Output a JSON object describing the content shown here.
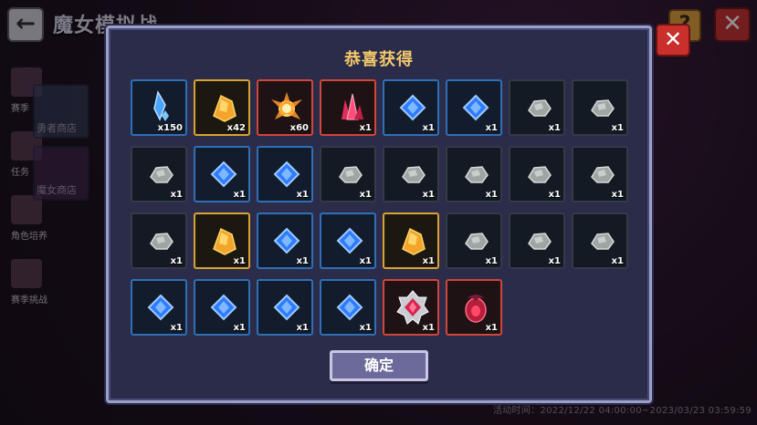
{
  "background": {
    "title": "魔女模拟战",
    "back_icon": "back-arrow-icon",
    "help_label": "?",
    "close_label": "✕",
    "side_menu": [
      {
        "label": "赛季"
      },
      {
        "label": "任务"
      },
      {
        "label": "角色培养"
      },
      {
        "label": "赛季挑战"
      }
    ],
    "shops": [
      {
        "label": "勇者商店"
      },
      {
        "label": "魔女商店"
      }
    ],
    "activity_time": "活动时间：2022/12/22 04:00:00~2023/03/23 03:59:59"
  },
  "dialog": {
    "title": "恭喜获得",
    "close_label": "✕",
    "confirm_label": "确定",
    "rewards": [
      {
        "icon": "blue-crystal-shard-icon",
        "count": "x150",
        "rarity": "blue"
      },
      {
        "icon": "gold-ore-icon",
        "count": "x42",
        "rarity": "gold"
      },
      {
        "icon": "flame-shard-icon",
        "count": "x60",
        "rarity": "red"
      },
      {
        "icon": "red-crystal-cluster-icon",
        "count": "x1",
        "rarity": "red"
      },
      {
        "icon": "blue-gem-icon",
        "count": "x1",
        "rarity": "blue"
      },
      {
        "icon": "blue-gem-icon",
        "count": "x1",
        "rarity": "blue"
      },
      {
        "icon": "grey-stone-icon",
        "count": "x1",
        "rarity": "plain"
      },
      {
        "icon": "grey-stone-icon",
        "count": "x1",
        "rarity": "plain"
      },
      {
        "icon": "grey-stone-icon",
        "count": "x1",
        "rarity": "plain"
      },
      {
        "icon": "blue-gem-icon",
        "count": "x1",
        "rarity": "blue"
      },
      {
        "icon": "blue-gem-icon",
        "count": "x1",
        "rarity": "blue"
      },
      {
        "icon": "grey-stone-icon",
        "count": "x1",
        "rarity": "plain"
      },
      {
        "icon": "grey-stone-icon",
        "count": "x1",
        "rarity": "plain"
      },
      {
        "icon": "grey-stone-icon",
        "count": "x1",
        "rarity": "plain"
      },
      {
        "icon": "grey-stone-icon",
        "count": "x1",
        "rarity": "plain"
      },
      {
        "icon": "grey-stone-icon",
        "count": "x1",
        "rarity": "plain"
      },
      {
        "icon": "grey-stone-icon",
        "count": "x1",
        "rarity": "plain"
      },
      {
        "icon": "gold-ore-icon",
        "count": "x1",
        "rarity": "gold"
      },
      {
        "icon": "blue-gem-icon",
        "count": "x1",
        "rarity": "blue"
      },
      {
        "icon": "blue-gem-icon",
        "count": "x1",
        "rarity": "blue"
      },
      {
        "icon": "gold-ore-icon",
        "count": "x1",
        "rarity": "gold"
      },
      {
        "icon": "grey-stone-icon",
        "count": "x1",
        "rarity": "plain"
      },
      {
        "icon": "grey-stone-icon",
        "count": "x1",
        "rarity": "plain"
      },
      {
        "icon": "grey-stone-icon",
        "count": "x1",
        "rarity": "plain"
      },
      {
        "icon": "blue-gem-icon",
        "count": "x1",
        "rarity": "blue"
      },
      {
        "icon": "blue-gem-icon",
        "count": "x1",
        "rarity": "blue"
      },
      {
        "icon": "blue-gem-icon",
        "count": "x1",
        "rarity": "blue"
      },
      {
        "icon": "blue-gem-icon",
        "count": "x1",
        "rarity": "blue"
      },
      {
        "icon": "silver-red-jewel-icon",
        "count": "x1",
        "rarity": "red"
      },
      {
        "icon": "dragon-egg-icon",
        "count": "x1",
        "rarity": "red"
      }
    ]
  },
  "colors": {
    "title_gold": "#f3c96a",
    "border_blue": "#2f6fb6",
    "border_gold": "#d8a233",
    "border_red": "#d0463a"
  }
}
